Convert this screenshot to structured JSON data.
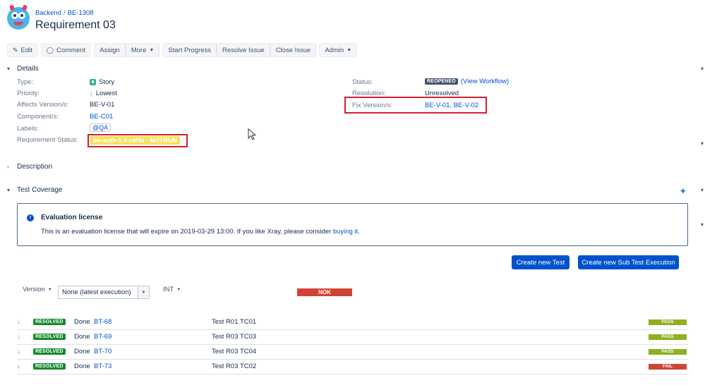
{
  "breadcrumb": {
    "project": "Backend",
    "separator": "/",
    "issue_key": "BE-1308"
  },
  "issue_title": "Requirement 03",
  "toolbar": {
    "edit": "Edit",
    "comment": "Comment",
    "assign": "Assign",
    "more": "More",
    "start_progress": "Start Progress",
    "resolve_issue": "Resolve Issue",
    "close_issue": "Close Issue",
    "admin": "Admin"
  },
  "details": {
    "heading": "Details",
    "type_label": "Type:",
    "type_value": "Story",
    "priority_label": "Priority:",
    "priority_value": "Lowest",
    "affects_label": "Affects Version/s:",
    "affects_value": "BE-V-01",
    "component_label": "Component/s:",
    "component_value": "BE-C01",
    "labels_label": "Labels:",
    "labels_value": "@QA",
    "req_status_label": "Requirement Status:",
    "req_status_value": "bs-auth-1.0-rafiki - NOTRUN",
    "status_label": "Status:",
    "status_value": "REOPENED",
    "view_workflow": "(View Workflow)",
    "resolution_label": "Resolution:",
    "resolution_value": "Unresolved",
    "fix_label": "Fix Version/s:",
    "fix_value": "BE-V-01, BE-V-02"
  },
  "description_heading": "Description",
  "test_coverage_heading": "Test Coverage",
  "license": {
    "title": "Evaluation license",
    "text_before": "This is an evaluation license that will expire on 2019-03-29 13:00. If you like Xray, please consider ",
    "link": "buying it",
    "text_after": "."
  },
  "actions": {
    "create_test": "Create new Test",
    "create_sub_exec": "Create new Sub Test Execution"
  },
  "filters": {
    "version_label": "Version",
    "version_value": "None (latest execution)",
    "env_label": "INT",
    "overall_status": "NOK"
  },
  "tests": [
    {
      "status": "RESOLVED",
      "resolution": "Done",
      "key": "BT-68",
      "summary": "Test R01 TC01",
      "result": "PASS"
    },
    {
      "status": "RESOLVED",
      "resolution": "Done",
      "key": "BT-69",
      "summary": "Test R03 TC03",
      "result": "PASS"
    },
    {
      "status": "RESOLVED",
      "resolution": "Done",
      "key": "BT-70",
      "summary": "Test R03 TC04",
      "result": "PASS"
    },
    {
      "status": "RESOLVED",
      "resolution": "Done",
      "key": "BT-73",
      "summary": "Test R03 TC02",
      "result": "FAIL"
    }
  ],
  "colors": {
    "accent": "#0052cc",
    "pass": "#8eb021",
    "fail": "#d04437",
    "highlight_box": "#d0212e",
    "req_status_bg": "#f6e05e"
  },
  "icons": [
    "project-avatar-icon",
    "pencil-icon",
    "comment-icon",
    "story-icon",
    "arrow-down-icon",
    "info-icon",
    "plus-icon",
    "mouse-cursor-icon"
  ]
}
